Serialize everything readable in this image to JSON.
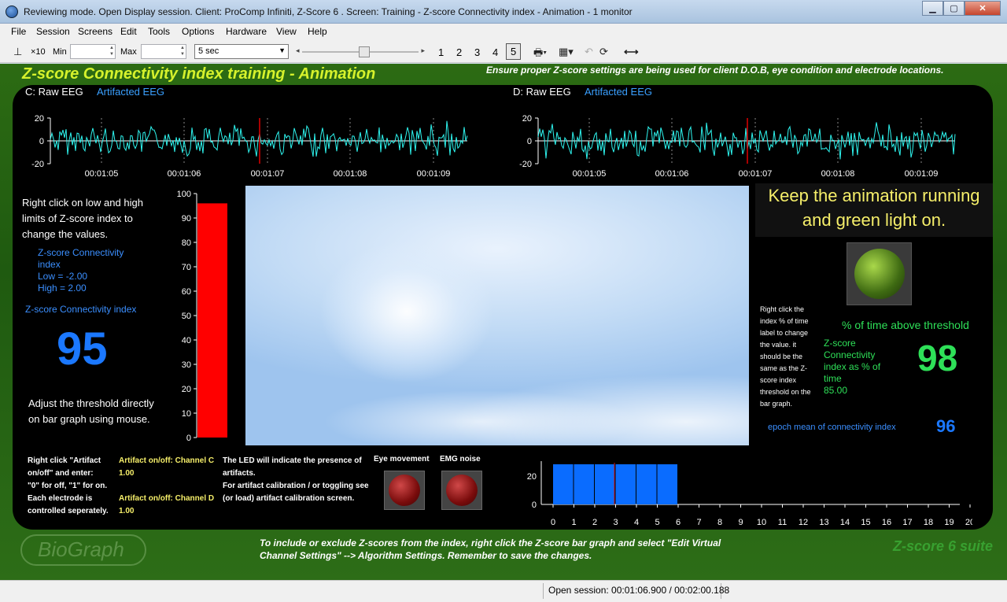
{
  "window": {
    "title": "Reviewing mode. Open Display session. Client: ProComp Infiniti, Z-Score 6 . Screen: Training - Z-score Connectivity index - Animation - 1 monitor"
  },
  "menu": [
    "File",
    "Session",
    "Screens",
    "Edit",
    "Tools",
    "Options",
    "Hardware",
    "View",
    "Help"
  ],
  "toolbar": {
    "scale_label": "×10",
    "min_label": "Min",
    "max_label": "Max",
    "timebase": "5 sec",
    "pages": [
      "1",
      "2",
      "3",
      "4",
      "5"
    ],
    "active_page": "5"
  },
  "header": {
    "title": "Z-score Connectivity index training - Animation",
    "note": "Ensure proper Z-score settings are being used for client D.O.B, eye condition and electrode locations."
  },
  "eeg_c": {
    "title": "C: Raw EEG",
    "subtitle": "Artifacted EEG",
    "y_ticks": [
      "20",
      "0",
      "-20"
    ],
    "x_ticks": [
      "00:01:05",
      "00:01:06",
      "00:01:07",
      "00:01:08",
      "00:01:09"
    ]
  },
  "eeg_d": {
    "title": "D: Raw EEG",
    "subtitle": "Artifacted EEG",
    "y_ticks": [
      "20",
      "0",
      "-20"
    ],
    "x_ticks": [
      "00:01:05",
      "00:01:06",
      "00:01:07",
      "00:01:08",
      "00:01:09"
    ]
  },
  "left": {
    "instructions": [
      "Right click on low and high",
      "limits of  Z-score index  to",
      "change the values."
    ],
    "limits": [
      "Z-score Connectivity",
      "index",
      "Low = -2.00",
      "High = 2.00"
    ],
    "index_label": "Z-score Connectivity  index",
    "index_value": "95",
    "adjust": [
      "Adjust the threshold directly",
      "on bar graph using mouse."
    ]
  },
  "bar_graph": {
    "ticks": [
      "100",
      "90",
      "80",
      "70",
      "60",
      "50",
      "40",
      "30",
      "20",
      "10",
      "0"
    ],
    "value": 96,
    "max": 100,
    "color": "#ff0000"
  },
  "right": {
    "keep_running": [
      "Keep the animation running",
      "and green light on."
    ],
    "help": [
      "Right click the",
      "index % of time",
      "label to change",
      "the value. it",
      "should be the",
      "same as the Z-",
      "score index",
      "threshold on the",
      "bar graph."
    ],
    "pct_label": "% of time above threshold",
    "pct_desc": [
      "Z-score",
      "Connectivity",
      "index as % of",
      "time",
      "85.00"
    ],
    "pct_value": "98",
    "epoch_label": "epoch mean of connectivity index",
    "epoch_value": "96"
  },
  "artifact": {
    "help": [
      "Right click \"Artifact",
      "on/off\" and enter:",
      "\"0\" for off, \"1\" for on.",
      "Each electrode is",
      "controlled seperately."
    ],
    "chan_c_label": "Artifact on/off: Channel C",
    "chan_c_value": "1.00",
    "chan_d_label": "Artifact on/off: Channel D",
    "chan_d_value": "1.00",
    "led_note": [
      "The LED will indicate the presence of",
      "artifacts.",
      "For artifact calibration / or toggling see",
      "(or load) artifact calibration screen."
    ],
    "eye_label": "Eye movement",
    "emg_label": "EMG noise"
  },
  "hist": {
    "y_ticks": [
      "20",
      "0"
    ],
    "x_ticks": [
      "0",
      "1",
      "2",
      "3",
      "4",
      "5",
      "6",
      "7",
      "8",
      "9",
      "10",
      "11",
      "12",
      "13",
      "14",
      "15",
      "16",
      "17",
      "18",
      "19",
      "20"
    ],
    "bars": [
      26,
      26,
      26,
      26,
      26,
      26
    ],
    "bar_color": "#0a6cff"
  },
  "footer": {
    "note": [
      "To include or exclude Z-scores from the index, right click the Z-score bar graph and select \"Edit Virtual",
      "Channel Settings\" --> Algorithm Settings. Remember to save the changes."
    ],
    "logo": "BioGraph",
    "suite": "Z-score 6 suite"
  },
  "status": {
    "session": "Open session: 00:01:06.900 / 00:02:00.188"
  }
}
